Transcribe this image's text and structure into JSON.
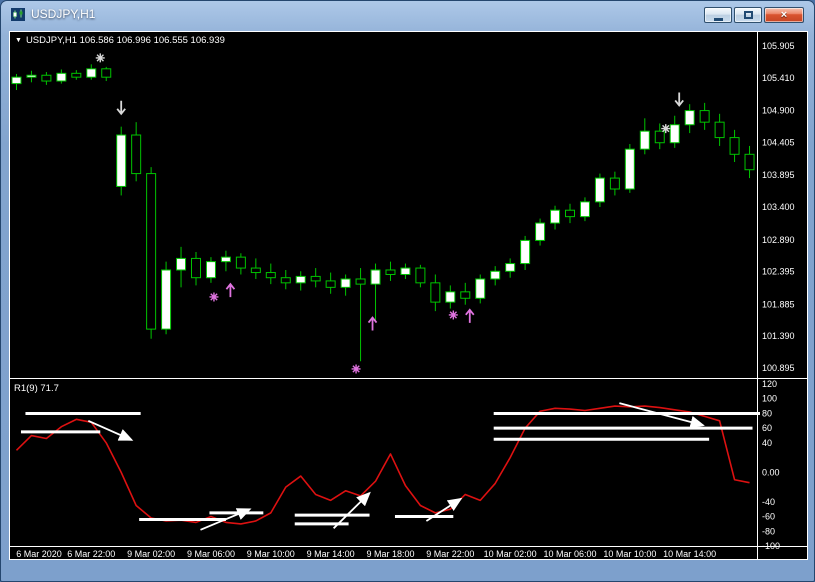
{
  "window": {
    "title": "USDJPY,H1",
    "icons": {
      "close": "×"
    }
  },
  "chart": {
    "header_arrow": "▼",
    "symbol_header": "USDJPY,H1 106.586 106.996 106.555 106.939",
    "indicator_label": "R1(9) 71.7",
    "price_axis": [
      "105.905",
      "105.410",
      "104.900",
      "104.405",
      "103.895",
      "103.400",
      "102.890",
      "102.395",
      "101.885",
      "101.390",
      "100.895"
    ],
    "indicator_axis": [
      "120",
      "100",
      "80",
      "60",
      "40",
      "0.00",
      "-40",
      "-60",
      "-80",
      "-100"
    ],
    "time_axis": [
      "6 Mar 2020",
      "6 Mar 22:00",
      "9 Mar 02:00",
      "9 Mar 06:00",
      "9 Mar 10:00",
      "9 Mar 14:00",
      "9 Mar 18:00",
      "9 Mar 22:00",
      "10 Mar 02:00",
      "10 Mar 06:00",
      "10 Mar 10:00",
      "10 Mar 14:00"
    ],
    "colors": {
      "background": "#000000",
      "candle": "#00c400",
      "bull_fill": "#ffffff",
      "bear_fill": "#000000",
      "indicator_line": "#dd1111",
      "objects": "#ffffff",
      "axis_text": "#ffffff",
      "signal_silver": "#d8d8d8",
      "signal_violet": "#df73df"
    }
  },
  "chart_data": {
    "type": "candlestick",
    "symbol": "USDJPY",
    "timeframe": "H1",
    "title": "USDJPY,H1",
    "price_axis_values": [
      105.905,
      105.41,
      104.9,
      104.405,
      103.895,
      103.4,
      102.89,
      102.395,
      101.885,
      101.39,
      100.895
    ],
    "indicator_axis_values": [
      120,
      100,
      80,
      60,
      40,
      0,
      -40,
      -60,
      -80,
      -100
    ],
    "time_label_indices": [
      1,
      5,
      9,
      13,
      17,
      21,
      25,
      29,
      33,
      37,
      41,
      45
    ],
    "candles": {
      "open": [
        105.32,
        105.42,
        105.45,
        105.36,
        105.48,
        105.42,
        105.55,
        103.72,
        104.52,
        103.92,
        101.5,
        102.42,
        102.6,
        102.3,
        102.55,
        102.62,
        102.45,
        102.38,
        102.3,
        102.22,
        102.32,
        102.25,
        102.15,
        102.28,
        102.2,
        102.42,
        102.35,
        102.45,
        102.22,
        101.92,
        102.08,
        101.98,
        102.28,
        102.4,
        102.52,
        102.88,
        103.15,
        103.35,
        103.25,
        103.48,
        103.85,
        103.68,
        104.3,
        104.58,
        104.4,
        104.68,
        104.9,
        104.72,
        104.48,
        104.22
      ],
      "high": [
        105.47,
        105.52,
        105.5,
        105.54,
        105.53,
        105.62,
        105.58,
        104.65,
        104.72,
        104.02,
        102.55,
        102.78,
        102.7,
        102.62,
        102.72,
        102.68,
        102.6,
        102.52,
        102.42,
        102.4,
        102.45,
        102.38,
        102.35,
        102.45,
        102.52,
        102.55,
        102.52,
        102.5,
        102.35,
        102.18,
        102.22,
        102.35,
        102.48,
        102.6,
        102.95,
        103.22,
        103.42,
        103.45,
        103.55,
        103.92,
        103.95,
        104.38,
        104.78,
        104.7,
        104.82,
        105.0,
        105.02,
        104.85,
        104.6,
        104.35
      ],
      "low": [
        105.22,
        105.34,
        105.3,
        105.32,
        105.38,
        105.38,
        105.36,
        103.58,
        103.8,
        101.35,
        101.42,
        102.15,
        102.18,
        102.22,
        102.4,
        102.35,
        102.28,
        102.2,
        102.12,
        102.1,
        102.15,
        102.05,
        102.02,
        101.0,
        101.62,
        102.25,
        102.28,
        102.15,
        101.78,
        101.82,
        101.88,
        101.9,
        102.18,
        102.3,
        102.42,
        102.8,
        103.05,
        103.15,
        103.18,
        103.4,
        103.58,
        103.62,
        104.22,
        104.3,
        104.32,
        104.55,
        104.6,
        104.35,
        104.1,
        103.85
      ],
      "close": [
        105.42,
        105.45,
        105.36,
        105.48,
        105.42,
        105.55,
        105.42,
        104.52,
        103.92,
        101.5,
        102.42,
        102.6,
        102.3,
        102.55,
        102.62,
        102.45,
        102.38,
        102.3,
        102.22,
        102.32,
        102.25,
        102.15,
        102.28,
        102.2,
        102.42,
        102.35,
        102.45,
        102.22,
        101.92,
        102.08,
        101.98,
        102.28,
        102.4,
        102.52,
        102.88,
        103.15,
        103.35,
        103.25,
        103.48,
        103.85,
        103.68,
        104.3,
        104.58,
        104.4,
        104.68,
        104.9,
        104.72,
        104.48,
        104.22,
        103.98
      ]
    },
    "indicator": {
      "name": "R1(9)",
      "display_value": 71.7,
      "values": [
        30,
        50,
        46,
        62,
        72,
        68,
        40,
        0,
        -45,
        -62,
        -66,
        -65,
        -68,
        -60,
        -68,
        -70,
        -66,
        -55,
        -20,
        -5,
        -30,
        -38,
        -25,
        -32,
        -12,
        25,
        -18,
        -45,
        -55,
        -50,
        -30,
        -38,
        -15,
        20,
        60,
        83,
        87,
        86,
        84,
        87,
        90,
        89,
        90,
        88,
        85,
        82,
        76,
        70,
        -10,
        -14
      ]
    },
    "markers": [
      {
        "i": 5.6,
        "price": 105.72,
        "kind": "star",
        "color": "#d8d8d8"
      },
      {
        "i": 7.0,
        "price": 104.85,
        "kind": "arrow-down",
        "color": "#d8d8d8"
      },
      {
        "i": 13.2,
        "price": 102.0,
        "kind": "star",
        "color": "#df73df"
      },
      {
        "i": 14.3,
        "price": 102.2,
        "kind": "arrow-up",
        "color": "#df73df"
      },
      {
        "i": 22.7,
        "price": 100.88,
        "kind": "star",
        "color": "#df73df"
      },
      {
        "i": 23.8,
        "price": 101.68,
        "kind": "arrow-up",
        "color": "#df73df"
      },
      {
        "i": 29.2,
        "price": 101.72,
        "kind": "star",
        "color": "#df73df"
      },
      {
        "i": 30.3,
        "price": 101.8,
        "kind": "arrow-up",
        "color": "#df73df"
      },
      {
        "i": 43.4,
        "price": 104.62,
        "kind": "star",
        "color": "#d8d8d8"
      },
      {
        "i": 44.3,
        "price": 104.98,
        "kind": "arrow-down",
        "color": "#d8d8d8"
      }
    ],
    "levels": [
      {
        "i1": 0.6,
        "i2": 8.3,
        "v": 80
      },
      {
        "i1": 0.3,
        "i2": 5.6,
        "v": 55
      },
      {
        "i1": 8.2,
        "i2": 14.0,
        "v": -64
      },
      {
        "i1": 12.9,
        "i2": 16.5,
        "v": -55
      },
      {
        "i1": 18.6,
        "i2": 23.6,
        "v": -58
      },
      {
        "i1": 18.6,
        "i2": 22.2,
        "v": -70
      },
      {
        "i1": 25.3,
        "i2": 29.2,
        "v": -60
      },
      {
        "i1": 31.9,
        "i2": 49.7,
        "v": 80
      },
      {
        "i1": 31.9,
        "i2": 49.2,
        "v": 60
      },
      {
        "i1": 31.9,
        "i2": 46.3,
        "v": 45
      }
    ],
    "trendlines": [
      {
        "i1": 4.8,
        "v1": 70,
        "i2": 7.7,
        "v2": 44
      },
      {
        "i1": 12.3,
        "v1": -78,
        "i2": 15.6,
        "v2": -50
      },
      {
        "i1": 21.2,
        "v1": -76,
        "i2": 23.6,
        "v2": -28
      },
      {
        "i1": 27.4,
        "v1": -66,
        "i2": 29.7,
        "v2": -36
      },
      {
        "i1": 40.3,
        "v1": 94,
        "i2": 45.9,
        "v2": 64
      }
    ]
  }
}
